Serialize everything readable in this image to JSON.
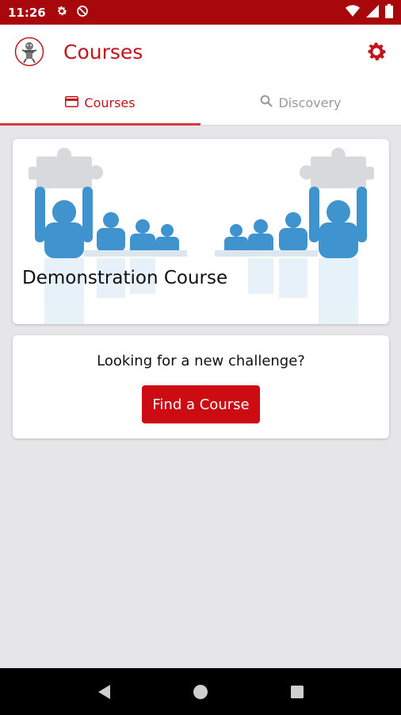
{
  "status_bar": {
    "time": "11:26",
    "icons": [
      "settings-icon",
      "no-disturb-icon",
      "wifi-icon",
      "signal-icon",
      "battery-icon"
    ]
  },
  "app_bar": {
    "title": "Courses",
    "icons": [
      "app-logo",
      "settings-icon"
    ]
  },
  "tabs": [
    {
      "label": "Courses",
      "icon": "card-icon",
      "active": true
    },
    {
      "label": "Discovery",
      "icon": "search-icon",
      "active": false
    }
  ],
  "course_card": {
    "title": "Demonstration Course"
  },
  "challenge_card": {
    "text": "Looking for a new challenge?",
    "button_label": "Find a Course"
  },
  "nav_bar": {
    "icons": [
      "back-icon",
      "home-icon",
      "recents-icon"
    ]
  },
  "colors": {
    "status_bar": "#a8070b",
    "accent": "#c2141b",
    "button": "#cc0b12",
    "illustration_blue": "#3f93cf",
    "puzzle_grey": "#d7d9dc",
    "background": "#e6e6e8"
  }
}
